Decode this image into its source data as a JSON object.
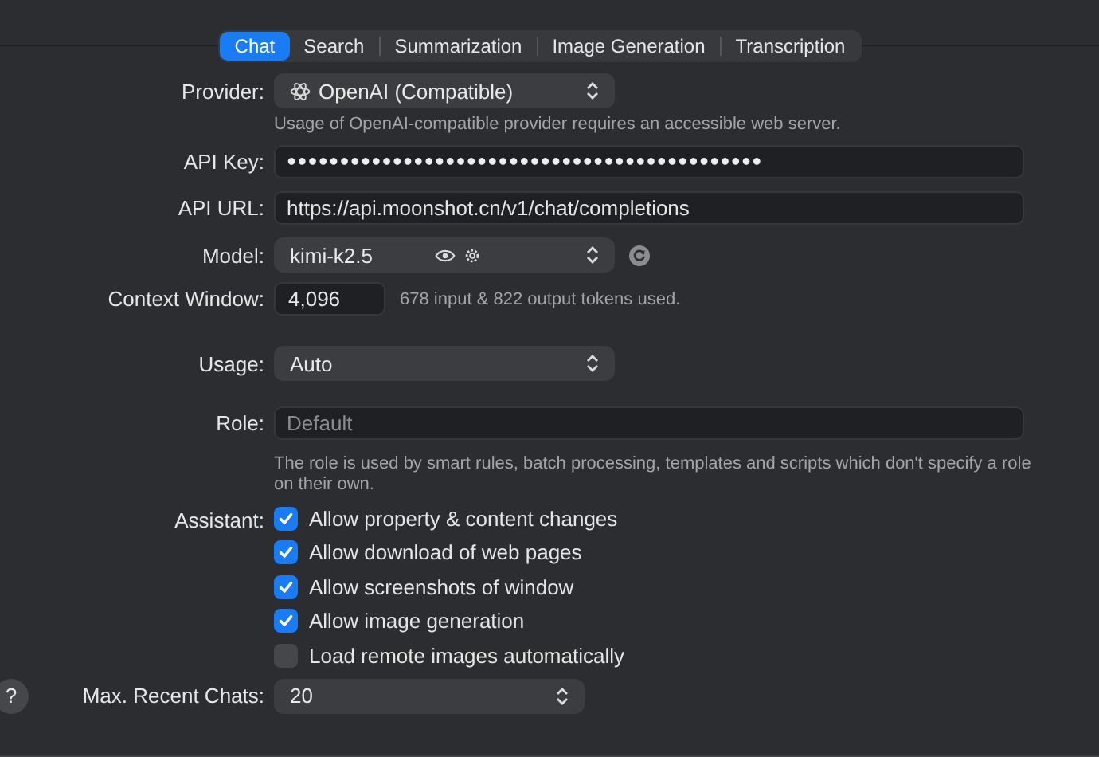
{
  "tabs": [
    {
      "label": "Chat",
      "selected": true
    },
    {
      "label": "Search",
      "selected": false
    },
    {
      "label": "Summarization",
      "selected": false
    },
    {
      "label": "Image Generation",
      "selected": false
    },
    {
      "label": "Transcription",
      "selected": false
    }
  ],
  "provider": {
    "label": "Provider:",
    "value": "OpenAI (Compatible)",
    "note": "Usage of OpenAI-compatible provider requires an accessible web server."
  },
  "api_key": {
    "label": "API Key:",
    "value": "●●●●●●●●●●●●●●●●●●●●●●●●●●●●●●●●●●●●●●●●●●●●●"
  },
  "api_url": {
    "label": "API URL:",
    "value": "https://api.moonshot.cn/v1/chat/completions"
  },
  "model": {
    "label": "Model:",
    "value": "kimi-k2.5"
  },
  "context_window": {
    "label": "Context Window:",
    "value": "4,096",
    "note": "678 input & 822 output tokens used."
  },
  "usage": {
    "label": "Usage:",
    "value": "Auto"
  },
  "role": {
    "label": "Role:",
    "placeholder": "Default",
    "note": "The role is used by smart rules, batch processing, templates and scripts which don't specify a role on their own."
  },
  "assistant": {
    "label": "Assistant:",
    "options": [
      {
        "label": "Allow property & content changes",
        "checked": true
      },
      {
        "label": "Allow download of web pages",
        "checked": true
      },
      {
        "label": "Allow screenshots of window",
        "checked": true
      },
      {
        "label": "Allow image generation",
        "checked": true
      },
      {
        "label": "Load remote images automatically",
        "checked": false
      }
    ]
  },
  "max_recent_chats": {
    "label": "Max. Recent Chats:",
    "value": "20"
  },
  "help_button": "?"
}
